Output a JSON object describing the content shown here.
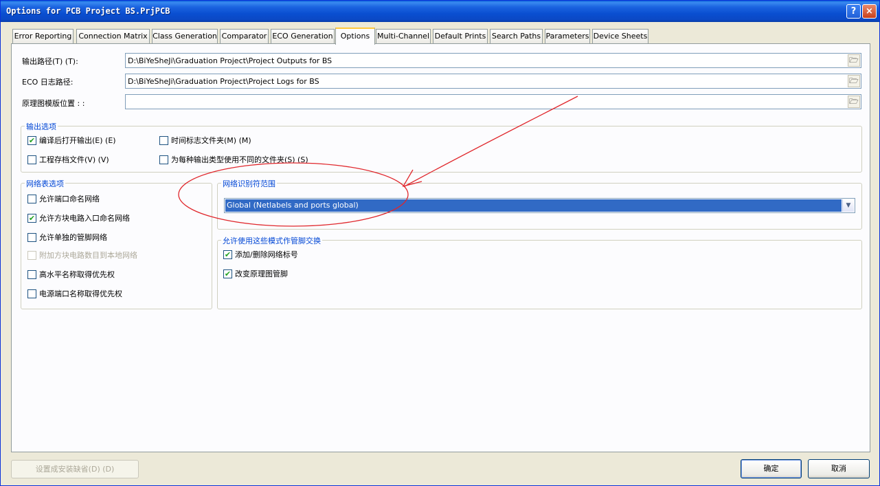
{
  "window": {
    "title": "Options for PCB Project BS.PrjPCB",
    "help_label": "?",
    "close_label": "×"
  },
  "tabs": [
    {
      "label": "Error Reporting"
    },
    {
      "label": "Connection Matrix"
    },
    {
      "label": "Class Generation"
    },
    {
      "label": "Comparator"
    },
    {
      "label": "ECO Generation"
    },
    {
      "label": "Options",
      "active": true
    },
    {
      "label": "Multi-Channel"
    },
    {
      "label": "Default Prints"
    },
    {
      "label": "Search Paths"
    },
    {
      "label": "Parameters"
    },
    {
      "label": "Device Sheets"
    }
  ],
  "paths": {
    "output_label": "输出路径(T) (T):",
    "output_value": "D:\\BiYeSheJi\\Graduation Project\\Project Outputs for BS",
    "eco_label": "ECO 日志路径:",
    "eco_value": "D:\\BiYeSheJi\\Graduation Project\\Project Logs for BS",
    "template_label": "原理图模版位置 : :",
    "template_value": "",
    "browse_icon": "folder-icon"
  },
  "output_options": {
    "title": "输出选项",
    "open_after_compile": {
      "label": "编译后打开输出(E) (E)",
      "checked": true
    },
    "timestamp_folder": {
      "label": "时间标志文件夹(M) (M)",
      "checked": false
    },
    "archive_project": {
      "label": "工程存档文件(V) (V)",
      "checked": false
    },
    "separate_folder": {
      "label": "为每种输出类型使用不同的文件夹(S) (S)",
      "checked": false
    }
  },
  "netlist_options": {
    "title": "网络表选项",
    "items": [
      {
        "label": "允许端口命名网络",
        "checked": false,
        "enabled": true
      },
      {
        "label": "允许方块电路入口命名网络",
        "checked": true,
        "enabled": true
      },
      {
        "label": "允许单独的管脚网络",
        "checked": false,
        "enabled": true
      },
      {
        "label": "附加方块电路数目到本地网络",
        "checked": false,
        "enabled": false
      },
      {
        "label": "高水平名称取得优先权",
        "checked": false,
        "enabled": true
      },
      {
        "label": "电源端口名称取得优先权",
        "checked": false,
        "enabled": true
      }
    ]
  },
  "net_scope": {
    "title": "网络识别符范围",
    "selected": "Global (Netlabels and ports global)",
    "dropdown_arrow": "chevron-down-icon"
  },
  "pin_swap": {
    "title": "允许使用这些模式作管脚交换",
    "items": [
      {
        "label": "添加/删除网络标号",
        "checked": true
      },
      {
        "label": "改变原理图管脚",
        "checked": true
      }
    ]
  },
  "buttons": {
    "set_default": "设置成安装缺省(D) (D)",
    "ok": "确定",
    "cancel": "取消"
  },
  "annotation": {
    "color": "#e0262b"
  },
  "check_mark": "✔"
}
